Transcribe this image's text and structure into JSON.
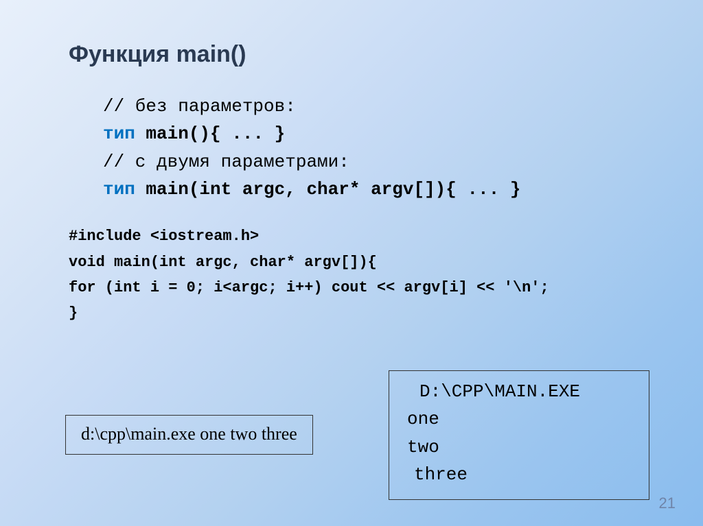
{
  "title": "Функция main()",
  "code1": {
    "c1": "// без параметров:",
    "c2a": "тип",
    "c2b": " main(){ ... }",
    "c3": "// с двумя параметрами:",
    "c4a": "тип",
    "c4b": " main(int argc, char* argv[]){ ... }"
  },
  "code2": {
    "l1": "#include <iostream.h>",
    "l2": "void main(int argc, char* argv[]){",
    "l3": "for (int i = 0; i<argc; i++) cout << argv[i] << '\\n';",
    "l4": "}"
  },
  "input_box": "d:\\cpp\\main.exe one two three",
  "output": {
    "o1": "D:\\CPP\\MAIN.EXE",
    "o2": "one",
    "o3": "two",
    "o4": "three"
  },
  "page_number": "21"
}
